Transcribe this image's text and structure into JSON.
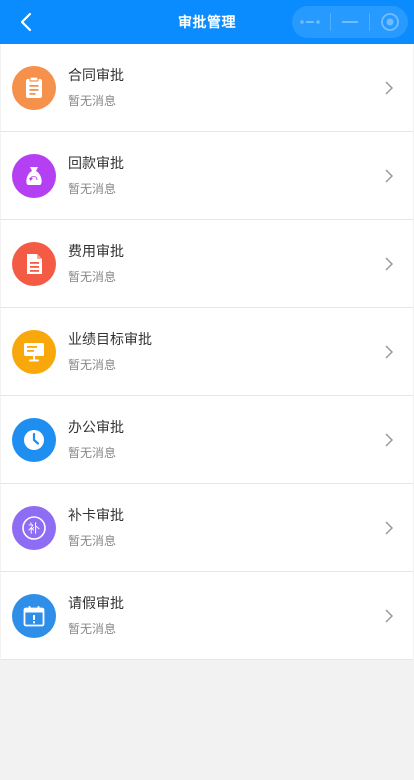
{
  "header": {
    "title": "审批管理"
  },
  "approvals": [
    {
      "title": "合同审批",
      "subtitle": "暂无消息",
      "icon": "clipboard-icon",
      "color": "#f5914a"
    },
    {
      "title": "回款审批",
      "subtitle": "暂无消息",
      "icon": "money-bag-icon",
      "color": "#b53ff2"
    },
    {
      "title": "费用审批",
      "subtitle": "暂无消息",
      "icon": "document-icon",
      "color": "#f45b45"
    },
    {
      "title": "业绩目标审批",
      "subtitle": "暂无消息",
      "icon": "presentation-board-icon",
      "color": "#f8a80a"
    },
    {
      "title": "办公审批",
      "subtitle": "暂无消息",
      "icon": "clock-icon",
      "color": "#1e8ff0"
    },
    {
      "title": "补卡审批",
      "subtitle": "暂无消息",
      "icon": "patch-card-icon",
      "color": "#8e6cf3"
    },
    {
      "title": "请假审批",
      "subtitle": "暂无消息",
      "icon": "calendar-icon",
      "color": "#2e8ee8"
    }
  ],
  "patch_card_glyph": "补"
}
